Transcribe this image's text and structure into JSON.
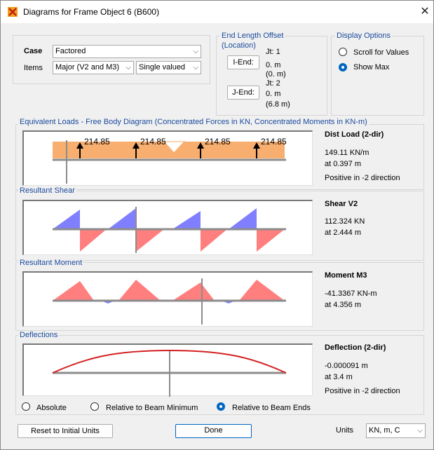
{
  "window": {
    "title": "Diagrams for Frame Object 6  (B600)"
  },
  "case": {
    "label": "Case",
    "value": "Factored",
    "items_label": "Items",
    "items_value": "Major (V2 and M3)",
    "valued_value": "Single valued"
  },
  "end_length": {
    "title_line1": "End Length Offset",
    "title_line2": "(Location)",
    "i_end_button": "I-End:",
    "j_end_button": "J-End:",
    "jt1": "Jt:  1",
    "i_val": "0. m",
    "i_loc": "(0. m)",
    "jt2": "Jt:  2",
    "j_val": "0. m",
    "j_loc": "(6.8 m)"
  },
  "display_options": {
    "title": "Display Options",
    "scroll_label": "Scroll for Values",
    "showmax_label": "Show Max",
    "selected": "Show Max"
  },
  "equiv_loads": {
    "title": "Equivalent Loads - Free Body Diagram  (Concentrated Forces in KN, Concentrated Moments in KN-m)",
    "point_loads": [
      "214.85",
      "214.85",
      "214.85",
      "214.85"
    ],
    "info_title": "Dist Load (2-dir)",
    "value": "149.11 KN/m",
    "at": "at 0.397 m",
    "direction": "Positive in -2 direction"
  },
  "shear": {
    "title": "Resultant Shear",
    "info_title": "Shear V2",
    "value": "112.324 KN",
    "at": "at 2.444 m"
  },
  "moment": {
    "title": "Resultant Moment",
    "info_title": "Moment M3",
    "value": "-41.3367 KN-m",
    "at": "at 4.356 m"
  },
  "deflections": {
    "title": "Deflections",
    "info_title": "Deflection (2-dir)",
    "value": "-0.000091 m",
    "at": "at 3.4 m",
    "direction": "Positive in -2 direction",
    "opt_absolute": "Absolute",
    "opt_min": "Relative to Beam Minimum",
    "opt_ends": "Relative to Beam Ends",
    "selected": "Relative to Beam Ends"
  },
  "footer": {
    "reset_button": "Reset to Initial Units",
    "done_button": "Done",
    "units_label": "Units",
    "units_value": "KN, m, C"
  },
  "colors": {
    "load_fill": "#f7ae6e",
    "shear_positive": "#7f7fff",
    "shear_negative": "#ff7f7f",
    "deflection_line": "#d42020",
    "accent": "#0067c0"
  }
}
